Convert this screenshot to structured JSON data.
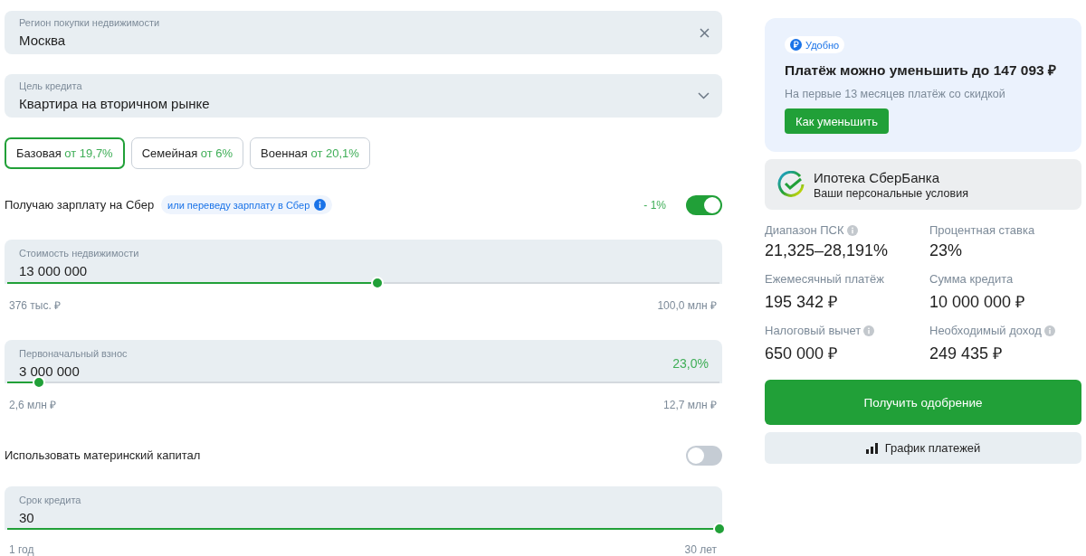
{
  "region_field": {
    "label": "Регион покупки недвижимости",
    "value": "Москва"
  },
  "purpose_field": {
    "label": "Цель кредита",
    "value": "Квартира на вторичном рынке"
  },
  "programs": [
    {
      "name": "Базовая",
      "rate": "от 19,7%",
      "selected": true
    },
    {
      "name": "Семейная",
      "rate": "от 6%",
      "selected": false
    },
    {
      "name": "Военная",
      "rate": "от 20,1%",
      "selected": false
    }
  ],
  "salary_toggle": {
    "label": "Получаю зарплату на Сбер",
    "hint": "или переведу зарплату в Сбер",
    "discount": "- 1%",
    "on": true
  },
  "sliders": [
    {
      "label": "Стоимость недвижимости",
      "value": "13 000 000",
      "min": "376 тыс. ₽",
      "max": "100,0 млн ₽",
      "level": 0.52
    },
    {
      "label": "Первоначальный взнос",
      "value": "3 000 000",
      "share": "23,0%",
      "min": "2,6 млн ₽",
      "max": "12,7 млн ₽",
      "level": 0.045
    },
    {
      "label": "Срок кредита",
      "value": "30",
      "min": "1 год",
      "max": "30 лет",
      "level": 1
    }
  ],
  "maternity_toggle": {
    "label": "Использовать материнский капитал",
    "on": false
  },
  "promo": {
    "badge": "Удобно",
    "title": "Платёж можно уменьшить до 147 093 ₽",
    "subtitle": "На первые 13 месяцев платёж со скидкой",
    "button": "Как уменьшить"
  },
  "bank": {
    "title": "Ипотека СберБанка",
    "subtitle": "Ваши персональные условия"
  },
  "stats": [
    {
      "label": "Диапазон ПСК",
      "value": "21,325–28,191%",
      "info": true
    },
    {
      "label": "Процентная ставка",
      "value": "23%",
      "info": false
    },
    {
      "label": "Ежемесячный платёж",
      "value": "195 342 ₽",
      "info": false
    },
    {
      "label": "Сумма кредита",
      "value": "10 000 000 ₽",
      "info": false
    },
    {
      "label": "Налоговый вычет",
      "value": "650 000 ₽",
      "info": true
    },
    {
      "label": "Необходимый доход",
      "value": "249 435 ₽",
      "info": true
    }
  ],
  "approve_button": "Получить одобрение",
  "schedule_button": "График платежей"
}
